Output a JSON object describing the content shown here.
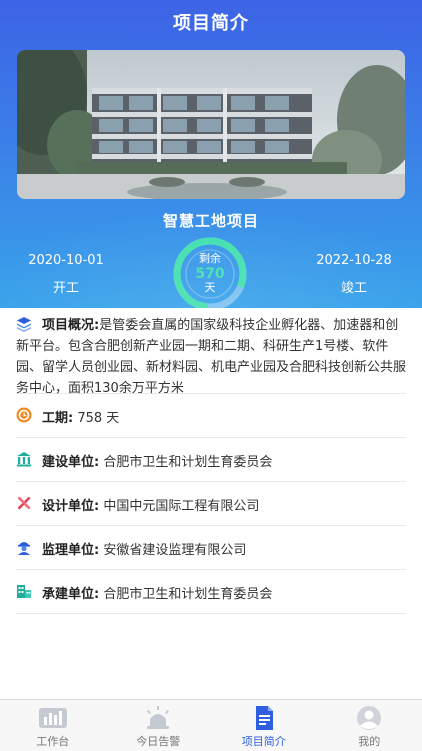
{
  "header": {
    "title": "项目简介"
  },
  "project": {
    "name": "智慧工地项目",
    "start_date": "2020-10-01",
    "start_label": "开工",
    "end_date": "2022-10-28",
    "end_label": "竣工",
    "remaining_label": "剩余",
    "remaining_days": "570",
    "remaining_unit": "天"
  },
  "details": {
    "overview_label": "项目概况:",
    "overview_text": "是管委会直属的国家级科技企业孵化器、加速器和创新平台。包含合肥创新产业园一期和二期、科研生产1号楼、软件园、留学人员创业园、新材料园、机电产业园及合肥科技创新公共服务中心，面积130余万平方米",
    "duration_label": "工期:",
    "duration_value": "758 天",
    "builder_label": "建设单位:",
    "builder_value": "合肥市卫生和计划生育委员会",
    "designer_label": "设计单位:",
    "designer_value": "中国中元国际工程有限公司",
    "supervisor_label": "监理单位:",
    "supervisor_value": "安徽省建设监理有限公司",
    "contractor_label": "承建单位:",
    "contractor_value": "合肥市卫生和计划生育委员会"
  },
  "tabs": [
    {
      "label": "工作台",
      "icon": "bar-chart-icon"
    },
    {
      "label": "今日告警",
      "icon": "alarm-icon"
    },
    {
      "label": "项目简介",
      "icon": "document-icon"
    },
    {
      "label": "我的",
      "icon": "user-icon"
    }
  ],
  "colors": {
    "header_gradient_top": "#3d63e6",
    "header_gradient_bottom": "#38a3ea",
    "ring_accent": "#44e0b0",
    "tab_active": "#2f5ee0"
  }
}
